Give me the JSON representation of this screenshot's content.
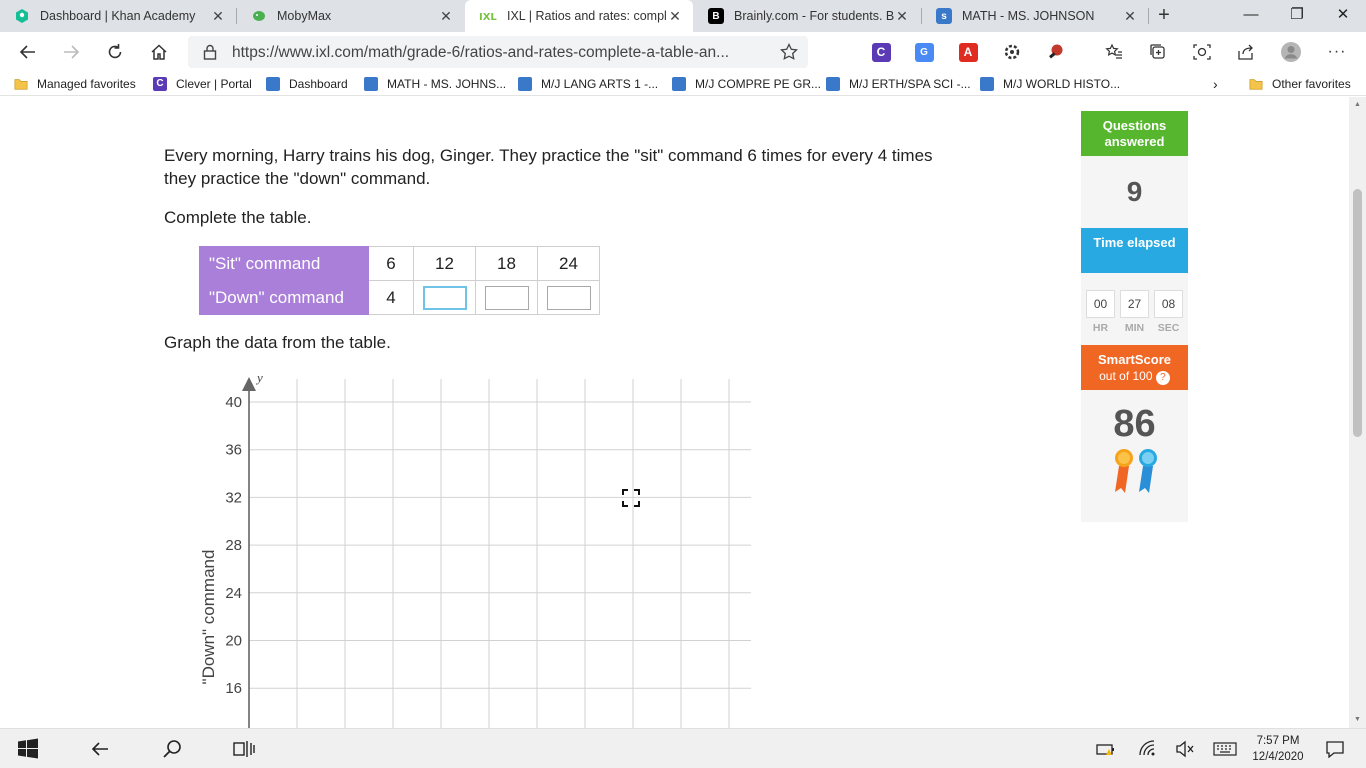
{
  "browser": {
    "tabs": [
      {
        "title": "Dashboard | Khan Academy",
        "icon": "khan-academy-icon",
        "color": "#14bf96"
      },
      {
        "title": "MobyMax",
        "icon": "mobymax-icon",
        "color": "#4caf50"
      },
      {
        "title": "IXL | Ratios and rates: complete",
        "icon": "ixl-icon",
        "color": "#7cc242"
      },
      {
        "title": "Brainly.com - For students. By",
        "icon": "brainly-icon",
        "color": "#000000"
      },
      {
        "title": "MATH - MS. JOHNSON",
        "icon": "schoology-icon",
        "color": "#3a78c9"
      }
    ],
    "url": "https://www.ixl.com/math/grade-6/ratios-and-rates-complete-a-table-an...",
    "favorites": [
      {
        "label": "Managed favorites",
        "icon": "folder-icon"
      },
      {
        "label": "Clever | Portal",
        "icon": "clever-icon"
      },
      {
        "label": "Dashboard",
        "icon": "schoology-icon"
      },
      {
        "label": "MATH - MS. JOHNS...",
        "icon": "schoology-icon"
      },
      {
        "label": "M/J LANG ARTS 1 -...",
        "icon": "schoology-icon"
      },
      {
        "label": "M/J COMPRE PE GR...",
        "icon": "schoology-icon"
      },
      {
        "label": "M/J ERTH/SPA SCI -...",
        "icon": "schoology-icon"
      },
      {
        "label": "M/J WORLD HISTO...",
        "icon": "schoology-icon"
      }
    ],
    "other_favorites": "Other favorites"
  },
  "question": {
    "text": "Every morning, Harry trains his dog, Ginger. They practice the \"sit\" command 6 times for every 4 times they practice the \"down\" command.",
    "instruction_table": "Complete the table.",
    "instruction_graph": "Graph the data from the table."
  },
  "ratio_table": {
    "row1_label": "\"Sit\" command",
    "row1_values": [
      "6",
      "12",
      "18",
      "24"
    ],
    "row2_label": "\"Down\" command",
    "row2_first": "4",
    "row2_inputs": [
      "",
      "",
      ""
    ]
  },
  "graph": {
    "y_axis_var": "y",
    "y_axis_label": "\"Down\" command",
    "y_ticks": [
      "40",
      "36",
      "32",
      "28",
      "24",
      "20",
      "16"
    ]
  },
  "sidebar": {
    "questions_label": "Questions answered",
    "questions_count": "9",
    "time_label": "Time elapsed",
    "timer": {
      "hr": "00",
      "min": "27",
      "sec": "08",
      "hr_label": "HR",
      "min_label": "MIN",
      "sec_label": "SEC"
    },
    "smartscore_label": "SmartScore",
    "smartscore_sub": "out of 100",
    "smartscore_value": "86"
  },
  "taskbar": {
    "time": "7:57 PM",
    "date": "12/4/2020"
  }
}
